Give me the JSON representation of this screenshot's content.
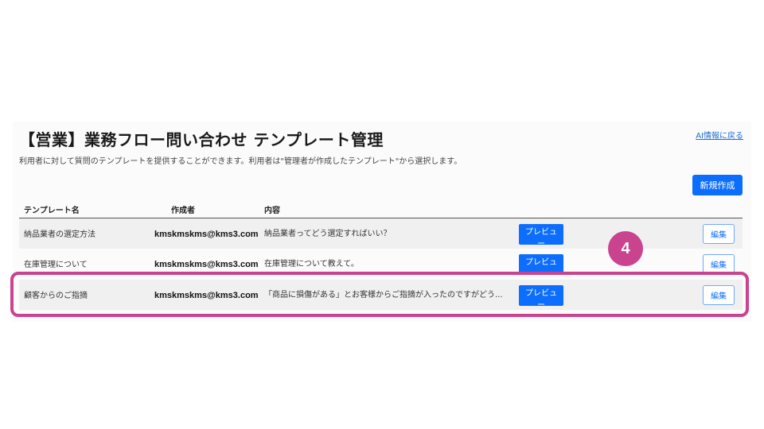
{
  "page": {
    "title": "【営業】業務フロー問い合わせ テンプレート管理",
    "subtitle": "利用者に対して質問のテンプレートを提供することができます。利用者は\"管理者が作成したテンプレート\"から選択します。",
    "back_link": "AI情報に戻る",
    "new_button": "新規作成"
  },
  "table": {
    "headers": {
      "name": "テンプレート名",
      "author": "作成者",
      "content": "内容"
    },
    "rows": [
      {
        "name": "納品業者の選定方法",
        "author": "kmskmskms@kms3.com",
        "content": "納品業者ってどう選定すればいい？",
        "preview": "プレビュー",
        "edit": "編集"
      },
      {
        "name": "在庫管理について",
        "author": "kmskmskms@kms3.com",
        "content": "在庫管理について教えて。",
        "preview": "プレビュー",
        "edit": "編集"
      },
      {
        "name": "顧客からのご指摘",
        "author": "kmskmskms@kms3.com",
        "content": "「商品に損傷がある」とお客様からご指摘が入ったのですがどう...",
        "preview": "プレビュー",
        "edit": "編集"
      }
    ]
  },
  "annotation": {
    "step_number": "4",
    "color": "#c9438f"
  },
  "colors": {
    "primary": "#0d6efd",
    "link": "#1a6fd6"
  }
}
